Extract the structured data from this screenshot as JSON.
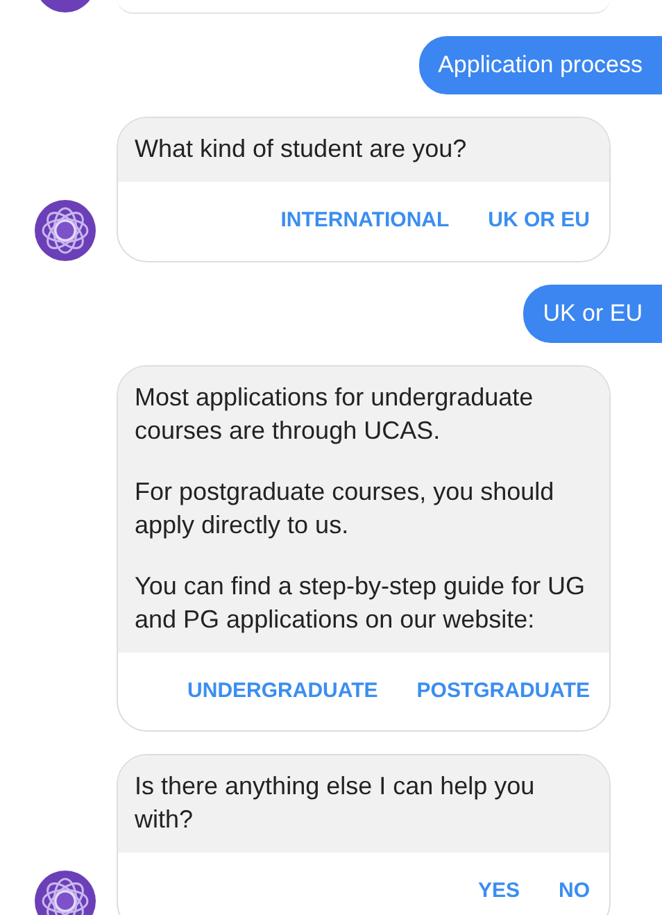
{
  "messages": [
    {
      "kind": "user",
      "text": "Application process"
    },
    {
      "kind": "bot",
      "avatar": true,
      "paragraphs": [
        "What kind of student are you?"
      ],
      "buttons": [
        "INTERNATIONAL",
        "UK OR EU"
      ]
    },
    {
      "kind": "user",
      "text": "UK or EU"
    },
    {
      "kind": "bot",
      "avatar": false,
      "paragraphs": [
        "Most applications for undergraduate courses are through UCAS.",
        "For postgraduate courses, you should apply directly to us.",
        "You can find a step-by-step guide for UG and PG applications on our website:"
      ],
      "buttons": [
        "UNDERGRADUATE",
        "POSTGRADUATE"
      ]
    },
    {
      "kind": "bot",
      "avatar": true,
      "paragraphs": [
        "Is there anything else I can help you with?"
      ],
      "buttons": [
        "YES",
        "NO"
      ]
    }
  ]
}
